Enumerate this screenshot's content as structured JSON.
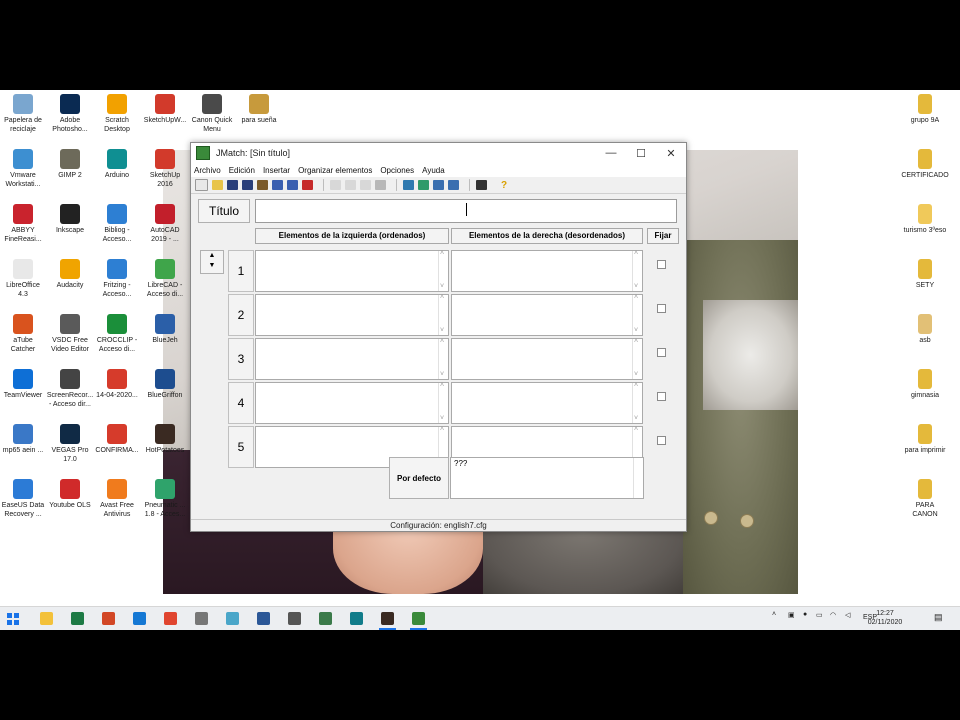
{
  "desktop": {
    "icons_left": [
      {
        "label": "Papelera de\nreciclaje",
        "color": "#7aa6cf"
      },
      {
        "label": "Adobe\nPhotosho...",
        "color": "#0a2a52"
      },
      {
        "label": "Scratch\nDesktop",
        "color": "#f2a100"
      },
      {
        "label": "SketchUpW...",
        "color": "#d23a2b"
      },
      {
        "label": "Canon Quick\nMenu",
        "color": "#4a4a4a"
      },
      {
        "label": "para sueña",
        "color": "#c79a3c"
      },
      {
        "label": "Vmware\nWorkstati...",
        "color": "#3d8fd1"
      },
      {
        "label": "GIMP 2",
        "color": "#6d6a5a"
      },
      {
        "label": "Arduino",
        "color": "#0f8f92"
      },
      {
        "label": "SketchUp\n2016",
        "color": "#d23a2b"
      },
      {
        "label": "ABBYY\nFineReasi...",
        "color": "#c9232d"
      },
      {
        "label": "Inkscape",
        "color": "#222222"
      },
      {
        "label": "Bibliog -\nAcceso...",
        "color": "#2d7fd3"
      },
      {
        "label": "AutoCAD\n2019 - ...",
        "color": "#c21f2b"
      },
      {
        "label": "LibreOffice\n4.3",
        "color": "#e8e8e8"
      },
      {
        "label": "Audacity",
        "color": "#f0a400"
      },
      {
        "label": "Fritzing -\nAcceso...",
        "color": "#2d7fd3"
      },
      {
        "label": "LibreCAD -\nAcceso di...",
        "color": "#3fa54a"
      },
      {
        "label": "aTube\nCatcher",
        "color": "#d9531e"
      },
      {
        "label": "VSDC Free\nVideo Editor",
        "color": "#5a5a5a"
      },
      {
        "label": "CROCCLIP -\nAcceso di...",
        "color": "#1b8f3a"
      },
      {
        "label": "BlueJeh",
        "color": "#2b5fa8"
      },
      {
        "label": "TeamViewer",
        "color": "#0e6fd6"
      },
      {
        "label": "ScreenRecor...\n- Acceso dir...",
        "color": "#444444"
      },
      {
        "label": "14-04-2020...",
        "color": "#d63b2b"
      },
      {
        "label": "BlueGriffon",
        "color": "#1d4d8f"
      },
      {
        "label": "mp65 aein ...",
        "color": "#3a78c7"
      },
      {
        "label": "VEGAS Pro\n17.0",
        "color": "#102a45"
      },
      {
        "label": "CONFIRMA...",
        "color": "#d63b2b"
      },
      {
        "label": "HotPotatoes",
        "color": "#3a2a22"
      },
      {
        "label": "EaseUS Data\nRecovery ...",
        "color": "#2c7bd6"
      },
      {
        "label": "Youtube OLS",
        "color": "#d02a2a"
      },
      {
        "label": "Avast Free\nAntivirus",
        "color": "#f07b1d"
      },
      {
        "label": "Pneumatic ...\n1.8 - Acces...",
        "color": "#2fa36b"
      }
    ],
    "icons_right": [
      {
        "label": "grupo 9A",
        "color": "#e4b93b"
      },
      {
        "label": "CERTIFICADO",
        "color": "#e4b93b"
      },
      {
        "label": "turismo 3ºeso",
        "color": "#f0c95a"
      },
      {
        "label": "SETY",
        "color": "#e4b93b"
      },
      {
        "label": "asb",
        "color": "#e2c076"
      },
      {
        "label": "gimnasia",
        "color": "#e4b93b"
      },
      {
        "label": "para imprimir",
        "color": "#e4b93b"
      },
      {
        "label": "PARA\nCANON",
        "color": "#e4b93b"
      }
    ]
  },
  "window": {
    "title": "JMatch: [Sin título]",
    "controls": {
      "minimize": "—",
      "maximize": "☐",
      "close": "✕"
    },
    "menu": [
      "Archivo",
      "Edición",
      "Insertar",
      "Organizar elementos",
      "Opciones",
      "Ayuda"
    ],
    "toolbar_help": "?",
    "titulo_label": "Título",
    "titulo_value": "",
    "left_header": "Elementos de la izquierda (ordenados)",
    "right_header": "Elementos de la derecha (desordenados)",
    "fijar_label": "Fijar",
    "rows": [
      {
        "num": "1",
        "left": "",
        "right": ""
      },
      {
        "num": "2",
        "left": "",
        "right": ""
      },
      {
        "num": "3",
        "left": "",
        "right": ""
      },
      {
        "num": "4",
        "left": "",
        "right": ""
      },
      {
        "num": "5",
        "left": "",
        "right": ""
      }
    ],
    "arrows": {
      "up": "▲",
      "down": "▼"
    },
    "default_label": "Por defecto",
    "default_value": "???",
    "status": "Configuración: english7.cfg"
  },
  "taskbar": {
    "apps": [
      {
        "name": "file-explorer",
        "color": "#f3c13a"
      },
      {
        "name": "excel",
        "color": "#1d7a45"
      },
      {
        "name": "powerpoint",
        "color": "#d24726"
      },
      {
        "name": "edge",
        "color": "#1578d4"
      },
      {
        "name": "chrome",
        "color": "#e0452f"
      },
      {
        "name": "pointer-app",
        "color": "#777777"
      },
      {
        "name": "app-7",
        "color": "#4aa6c9"
      },
      {
        "name": "word",
        "color": "#2b5797"
      },
      {
        "name": "camera",
        "color": "#555555"
      },
      {
        "name": "app-10",
        "color": "#3b7a4a"
      },
      {
        "name": "app-11",
        "color": "#117c8a"
      },
      {
        "name": "hotpotatoes",
        "color": "#3a2a22"
      },
      {
        "name": "jmatch",
        "color": "#3a8a3a"
      }
    ],
    "language": "ESP",
    "time": "12:27",
    "date": "02/11/2020"
  }
}
